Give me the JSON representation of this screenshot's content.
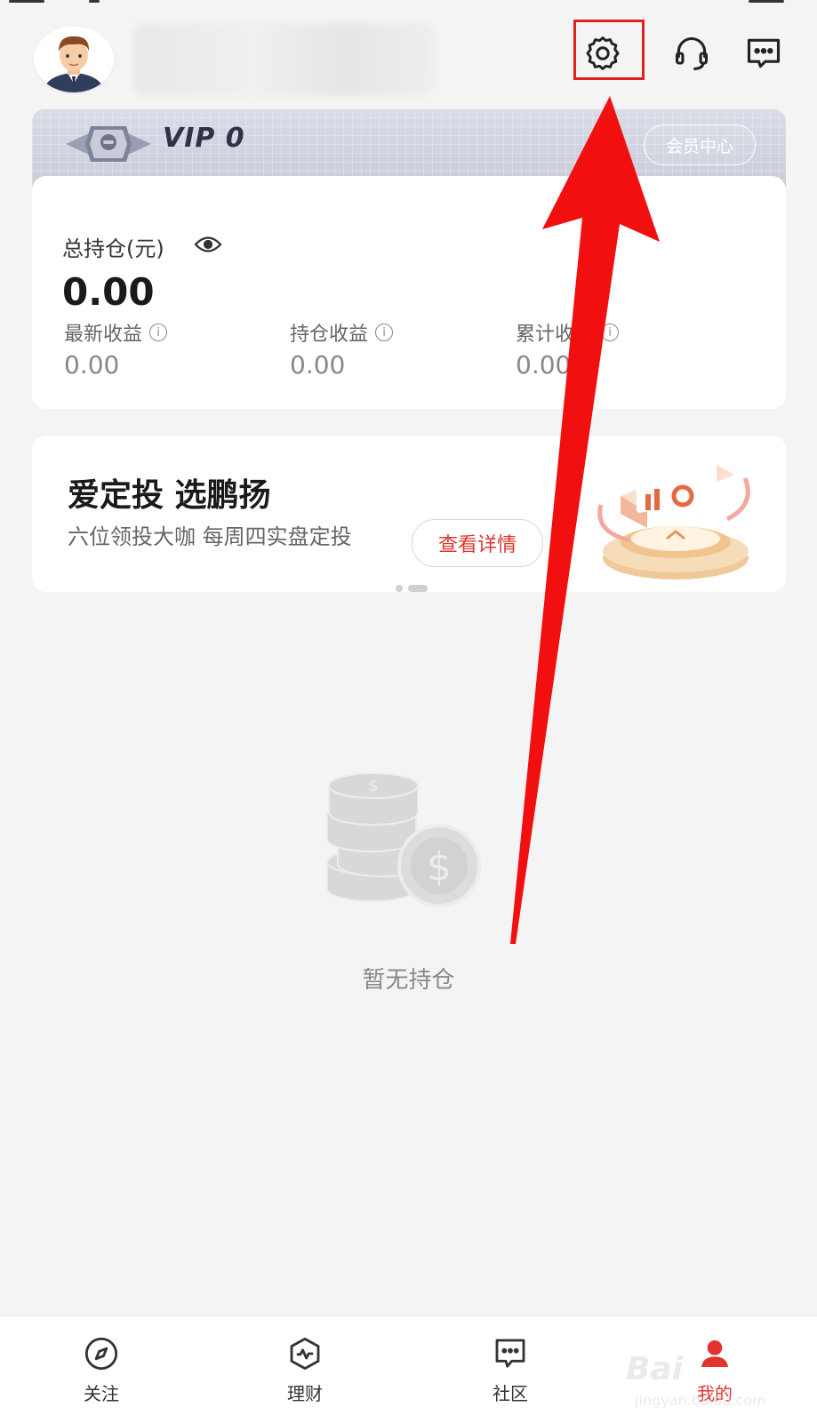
{
  "header": {
    "settings_icon": "gear-icon",
    "support_icon": "headset-icon",
    "messages_icon": "message-icon"
  },
  "vip": {
    "level_text": "VIP 0",
    "member_center": "会员中心"
  },
  "holdings": {
    "total_label": "总持仓(元)",
    "total_value": "0.00",
    "stats": [
      {
        "label": "最新收益",
        "value": "0.00"
      },
      {
        "label": "持仓收益",
        "value": "0.00"
      },
      {
        "label": "累计收益",
        "value": "0.00"
      }
    ]
  },
  "promo": {
    "title": "爱定投 选鹏扬",
    "subtitle": "六位领投大咖 每周四实盘定投",
    "button": "查看详情"
  },
  "empty": {
    "text": "暂无持仓"
  },
  "nav": [
    {
      "label": "关注",
      "icon": "compass-icon"
    },
    {
      "label": "理财",
      "icon": "pulse-icon"
    },
    {
      "label": "社区",
      "icon": "chat-icon"
    },
    {
      "label": "我的",
      "icon": "user-icon"
    }
  ],
  "watermark": {
    "brand": "Bai",
    "url": "jingyan.baidu.com"
  },
  "colors": {
    "accent": "#e0342d",
    "annotation": "#e0221e"
  }
}
